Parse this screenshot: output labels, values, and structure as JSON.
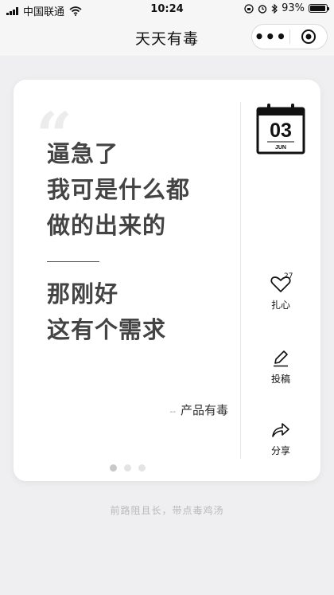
{
  "status_bar": {
    "carrier": "中国联通",
    "time": "10:24",
    "battery": "93%",
    "battery_level": 0.93
  },
  "nav": {
    "title": "天天有毒",
    "more_label": "•••"
  },
  "card": {
    "quote_mark": "“",
    "lines_top": [
      "逼急了",
      "我可是什么都",
      "做的出来的"
    ],
    "lines_bottom": [
      "那刚好",
      "这有个需求"
    ],
    "author_dash": "--",
    "author": "产品有毒"
  },
  "calendar": {
    "day": "03",
    "month": "JUN"
  },
  "actions": {
    "like": {
      "label": "扎心",
      "count": "27",
      "icon": "heart-icon"
    },
    "submit": {
      "label": "投稿",
      "icon": "pencil-icon"
    },
    "share": {
      "label": "分享",
      "icon": "share-arrow-icon"
    }
  },
  "pagination": {
    "count": 3,
    "active": 1
  },
  "footer": {
    "text": "前路阻且长，带点毒鸡汤"
  }
}
